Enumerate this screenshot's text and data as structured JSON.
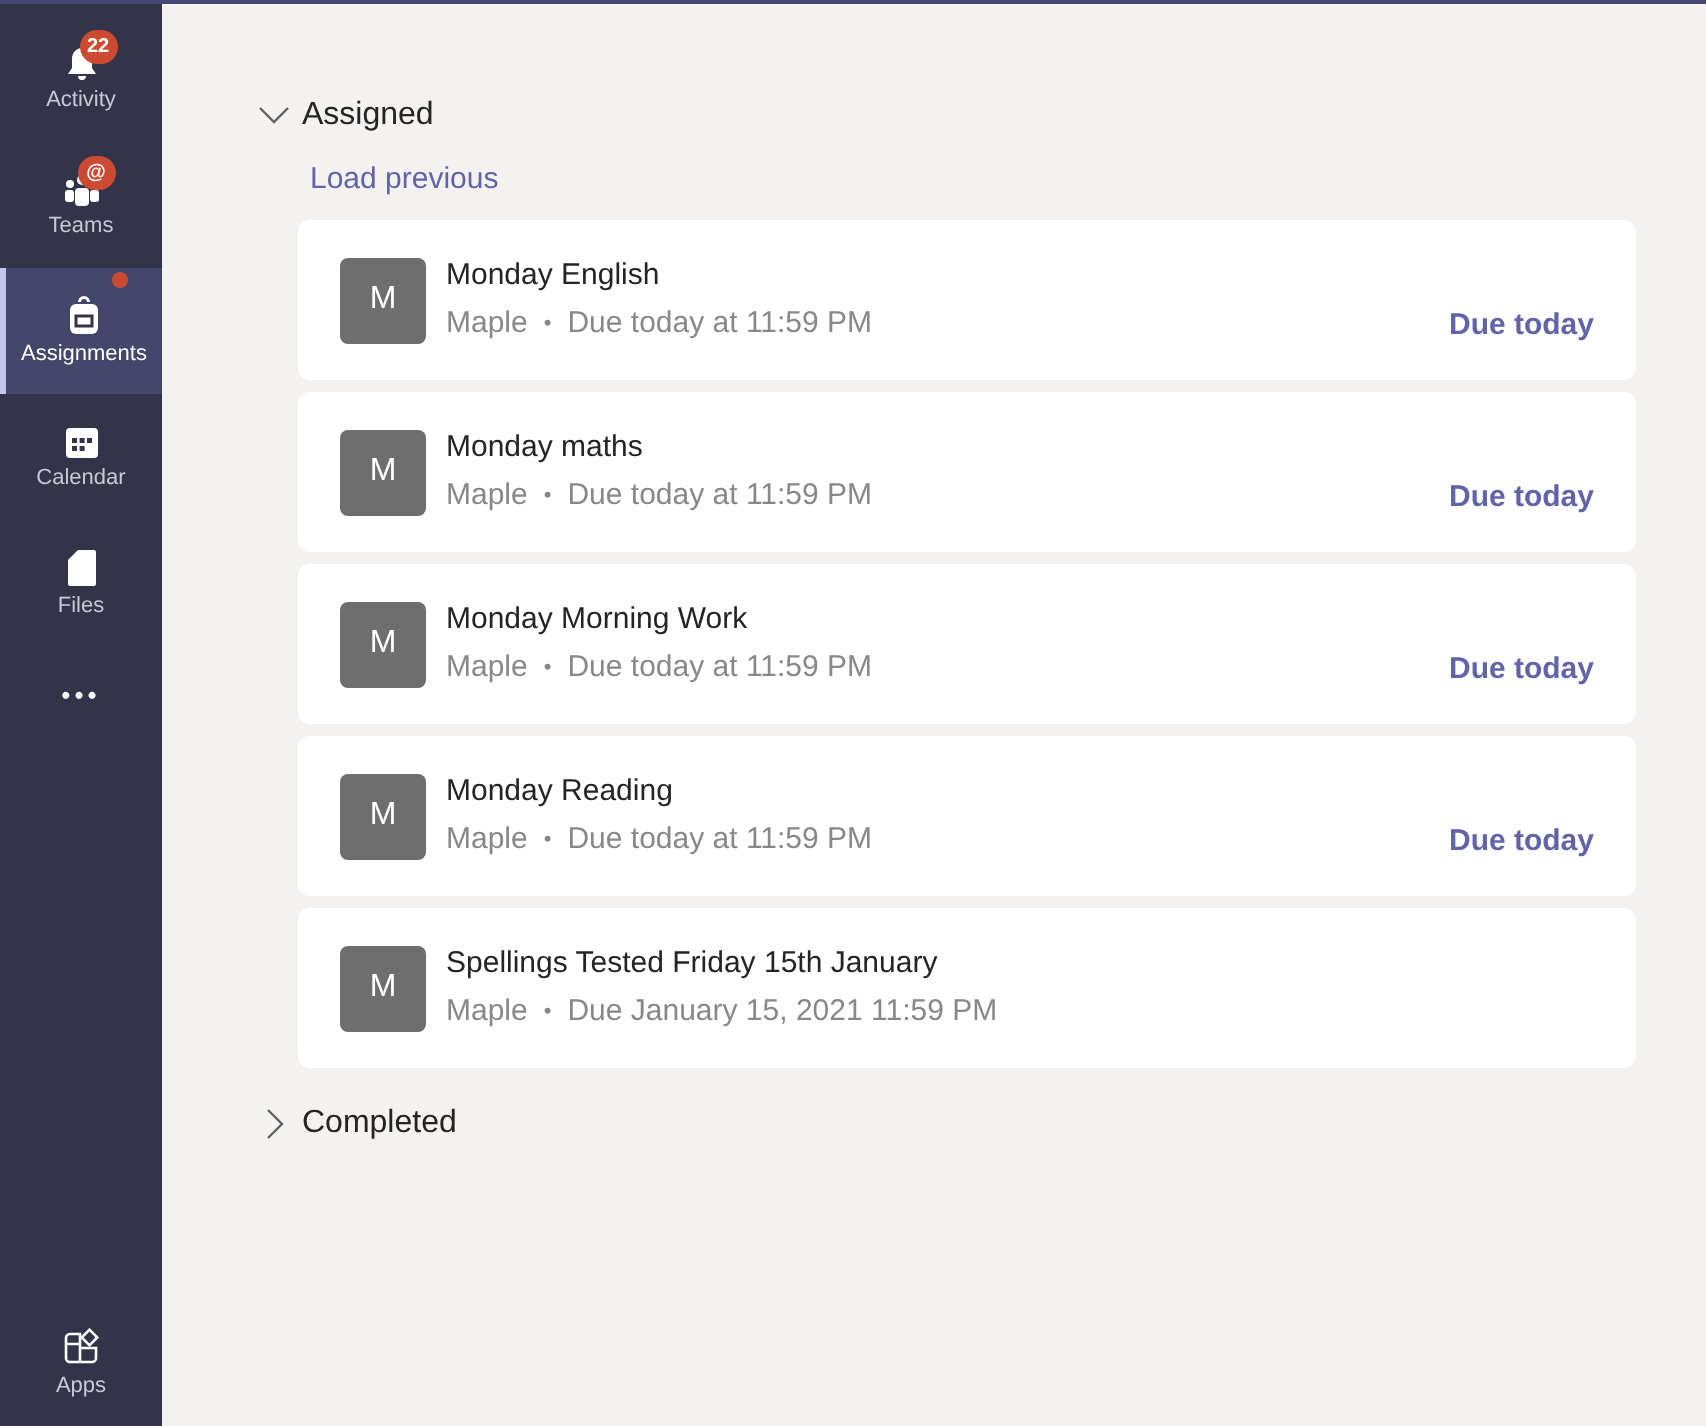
{
  "sidebar": {
    "items": [
      {
        "kind": "activity",
        "label": "Activity",
        "selected": false,
        "badge": "22"
      },
      {
        "kind": "teams",
        "label": "Teams",
        "selected": false,
        "badge": "@"
      },
      {
        "kind": "assignments",
        "label": "Assignments",
        "selected": true,
        "dot": true
      },
      {
        "kind": "calendar",
        "label": "Calendar",
        "selected": false
      },
      {
        "kind": "files",
        "label": "Files",
        "selected": false
      },
      {
        "kind": "more",
        "label": "•••",
        "selected": false
      }
    ],
    "bottom": {
      "kind": "apps",
      "label": "Apps",
      "selected": false
    }
  },
  "assigned": {
    "label": "Assigned",
    "expanded": true,
    "load_previous": "Load previous",
    "items": [
      {
        "avatar": "M",
        "title": "Monday English",
        "class": "Maple",
        "separator": "•",
        "due": "Due today at 11:59 PM",
        "status": "Due today"
      },
      {
        "avatar": "M",
        "title": "Monday maths",
        "class": "Maple",
        "separator": "•",
        "due": "Due today at 11:59 PM",
        "status": "Due today"
      },
      {
        "avatar": "M",
        "title": "Monday Morning Work",
        "class": "Maple",
        "separator": "•",
        "due": "Due today at 11:59 PM",
        "status": "Due today"
      },
      {
        "avatar": "M",
        "title": "Monday Reading",
        "class": "Maple",
        "separator": "•",
        "due": "Due today at 11:59 PM",
        "status": "Due today"
      },
      {
        "avatar": "M",
        "title": "Spellings Tested Friday 15th January",
        "class": "Maple",
        "separator": "•",
        "due": "Due January 15, 2021 11:59 PM"
      }
    ]
  },
  "completed": {
    "label": "Completed",
    "expanded": false
  }
}
